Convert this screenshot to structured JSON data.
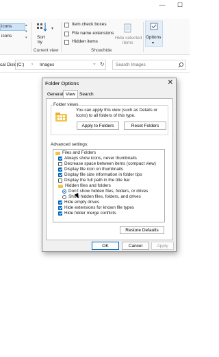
{
  "window_controls": {
    "minimize": "—",
    "maximize": "☐"
  },
  "ribbon": {
    "selected_fragment": "icons",
    "fragment_2": "icons",
    "sort_by": {
      "label": "Sort",
      "label2": "by"
    },
    "checkboxes": [
      {
        "label": "Item check boxes",
        "checked": false
      },
      {
        "label": "File name extensions",
        "checked": false
      },
      {
        "label": "Hidden items",
        "checked": false
      }
    ],
    "hide_selected": {
      "line1": "Hide selected",
      "line2": "items"
    },
    "options": {
      "label": "Options",
      "arrow": "▾"
    },
    "groups": {
      "current_view": "Current view",
      "show_hide": "Show/hide"
    }
  },
  "address": {
    "path_prefix": "cal Disk (C:)",
    "separator": "›",
    "current": "Images",
    "dropdown": "⌄",
    "refresh": "↻"
  },
  "search": {
    "placeholder": "Search Images",
    "icon": "search-icon"
  },
  "dialog": {
    "title": "Folder Options",
    "close": "✕",
    "tabs": [
      "General",
      "View",
      "Search"
    ],
    "active_tab": "View",
    "folder_views": {
      "legend": "Folder views",
      "description": "You can apply this view (such as Details or Icons) to all folders of this type.",
      "apply_button": "Apply to Folders",
      "reset_button": "Reset Folders"
    },
    "advanced_label": "Advanced settings:",
    "tree": [
      {
        "kind": "folder",
        "label": "Files and Folders",
        "indent": 0
      },
      {
        "kind": "check",
        "checked": true,
        "label": "Always show icons, never thumbnails",
        "indent": 1
      },
      {
        "kind": "check",
        "checked": false,
        "label": "Decrease space between items (compact view)",
        "indent": 1
      },
      {
        "kind": "check",
        "checked": true,
        "label": "Display file icon on thumbnails",
        "indent": 1
      },
      {
        "kind": "check",
        "checked": true,
        "label": "Display file size information in folder tips",
        "indent": 1
      },
      {
        "kind": "check",
        "checked": false,
        "label": "Display the full path in the title bar",
        "indent": 1
      },
      {
        "kind": "folder",
        "label": "Hidden files and folders",
        "indent": 1
      },
      {
        "kind": "radio",
        "checked": true,
        "label": "Don't show hidden files, folders, or drives",
        "indent": 2
      },
      {
        "kind": "radio",
        "checked": false,
        "label": "Show hidden files, folders, and drives",
        "indent": 2
      },
      {
        "kind": "check",
        "checked": true,
        "label": "Hide empty drives",
        "indent": 1
      },
      {
        "kind": "check",
        "checked": true,
        "label": "Hide extensions for known file types",
        "indent": 1
      },
      {
        "kind": "check",
        "checked": true,
        "label": "Hide folder merge conflicts",
        "indent": 1
      }
    ],
    "restore_button": "Restore Defaults",
    "ok_button": "OK",
    "cancel_button": "Cancel",
    "apply_button": "Apply"
  },
  "colors": {
    "accent": "#0067c0",
    "selection": "#cfe3f6",
    "dialog_bg": "#f0f0f0"
  }
}
